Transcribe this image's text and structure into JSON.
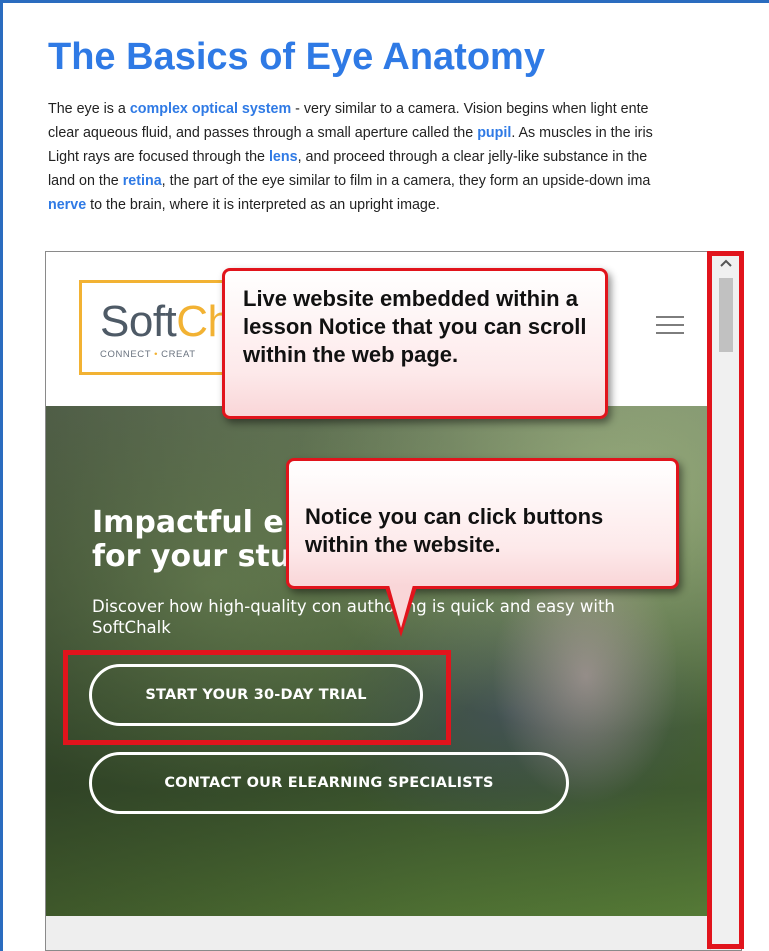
{
  "lesson": {
    "title": "The Basics of Eye Anatomy",
    "paragraph": [
      {
        "parts": [
          {
            "t": "The eye is a "
          },
          {
            "t": "complex optical system",
            "link": true
          },
          {
            "t": " - very similar to a camera. Vision begins when light ente"
          }
        ]
      },
      {
        "parts": [
          {
            "t": "clear aqueous fluid, and passes through a small aperture called the "
          },
          {
            "t": "pupil",
            "link": true
          },
          {
            "t": ". As muscles in the iris"
          }
        ]
      },
      {
        "parts": [
          {
            "t": "Light rays are focused through the "
          },
          {
            "t": "lens",
            "link": true
          },
          {
            "t": ", and proceed through a clear jelly-like substance in the"
          }
        ]
      },
      {
        "parts": [
          {
            "t": "land on the "
          },
          {
            "t": "retina",
            "link": true
          },
          {
            "t": ", the part of the eye similar to film in a camera, they form an upside-down ima"
          }
        ]
      },
      {
        "parts": [
          {
            "t": "nerve",
            "link": true
          },
          {
            "t": " to the brain, where it is interpreted as an upright image."
          }
        ]
      }
    ]
  },
  "embedded_site": {
    "logo": {
      "word_start": "Soft",
      "word_accent": "Ch",
      "tag_left": "CONNECT",
      "tag_right": "CREAT"
    },
    "menu_icon": "hamburger-icon",
    "hero": {
      "heading_line1": "Impactful e",
      "heading_line2": "for your stu",
      "subtext": "Discover how high-quality con       authoring is quick and easy with SoftChalk",
      "trial_button": "START YOUR 30-DAY TRIAL",
      "contact_button": "CONTACT OUR ELEARNING SPECIALISTS"
    },
    "scrollbar": {
      "up_icon": "chevron-up-icon"
    }
  },
  "callouts": {
    "live_website": "Live website embedded within a lesson Notice that you can scroll within the web page.",
    "click_buttons": "Notice you can click buttons within the website."
  },
  "colors": {
    "title": "#2f7ae5",
    "link": "#2f7ae5",
    "highlight": "#e1141c",
    "logo_accent": "#f2b233",
    "page_border": "#2a6cbf"
  }
}
